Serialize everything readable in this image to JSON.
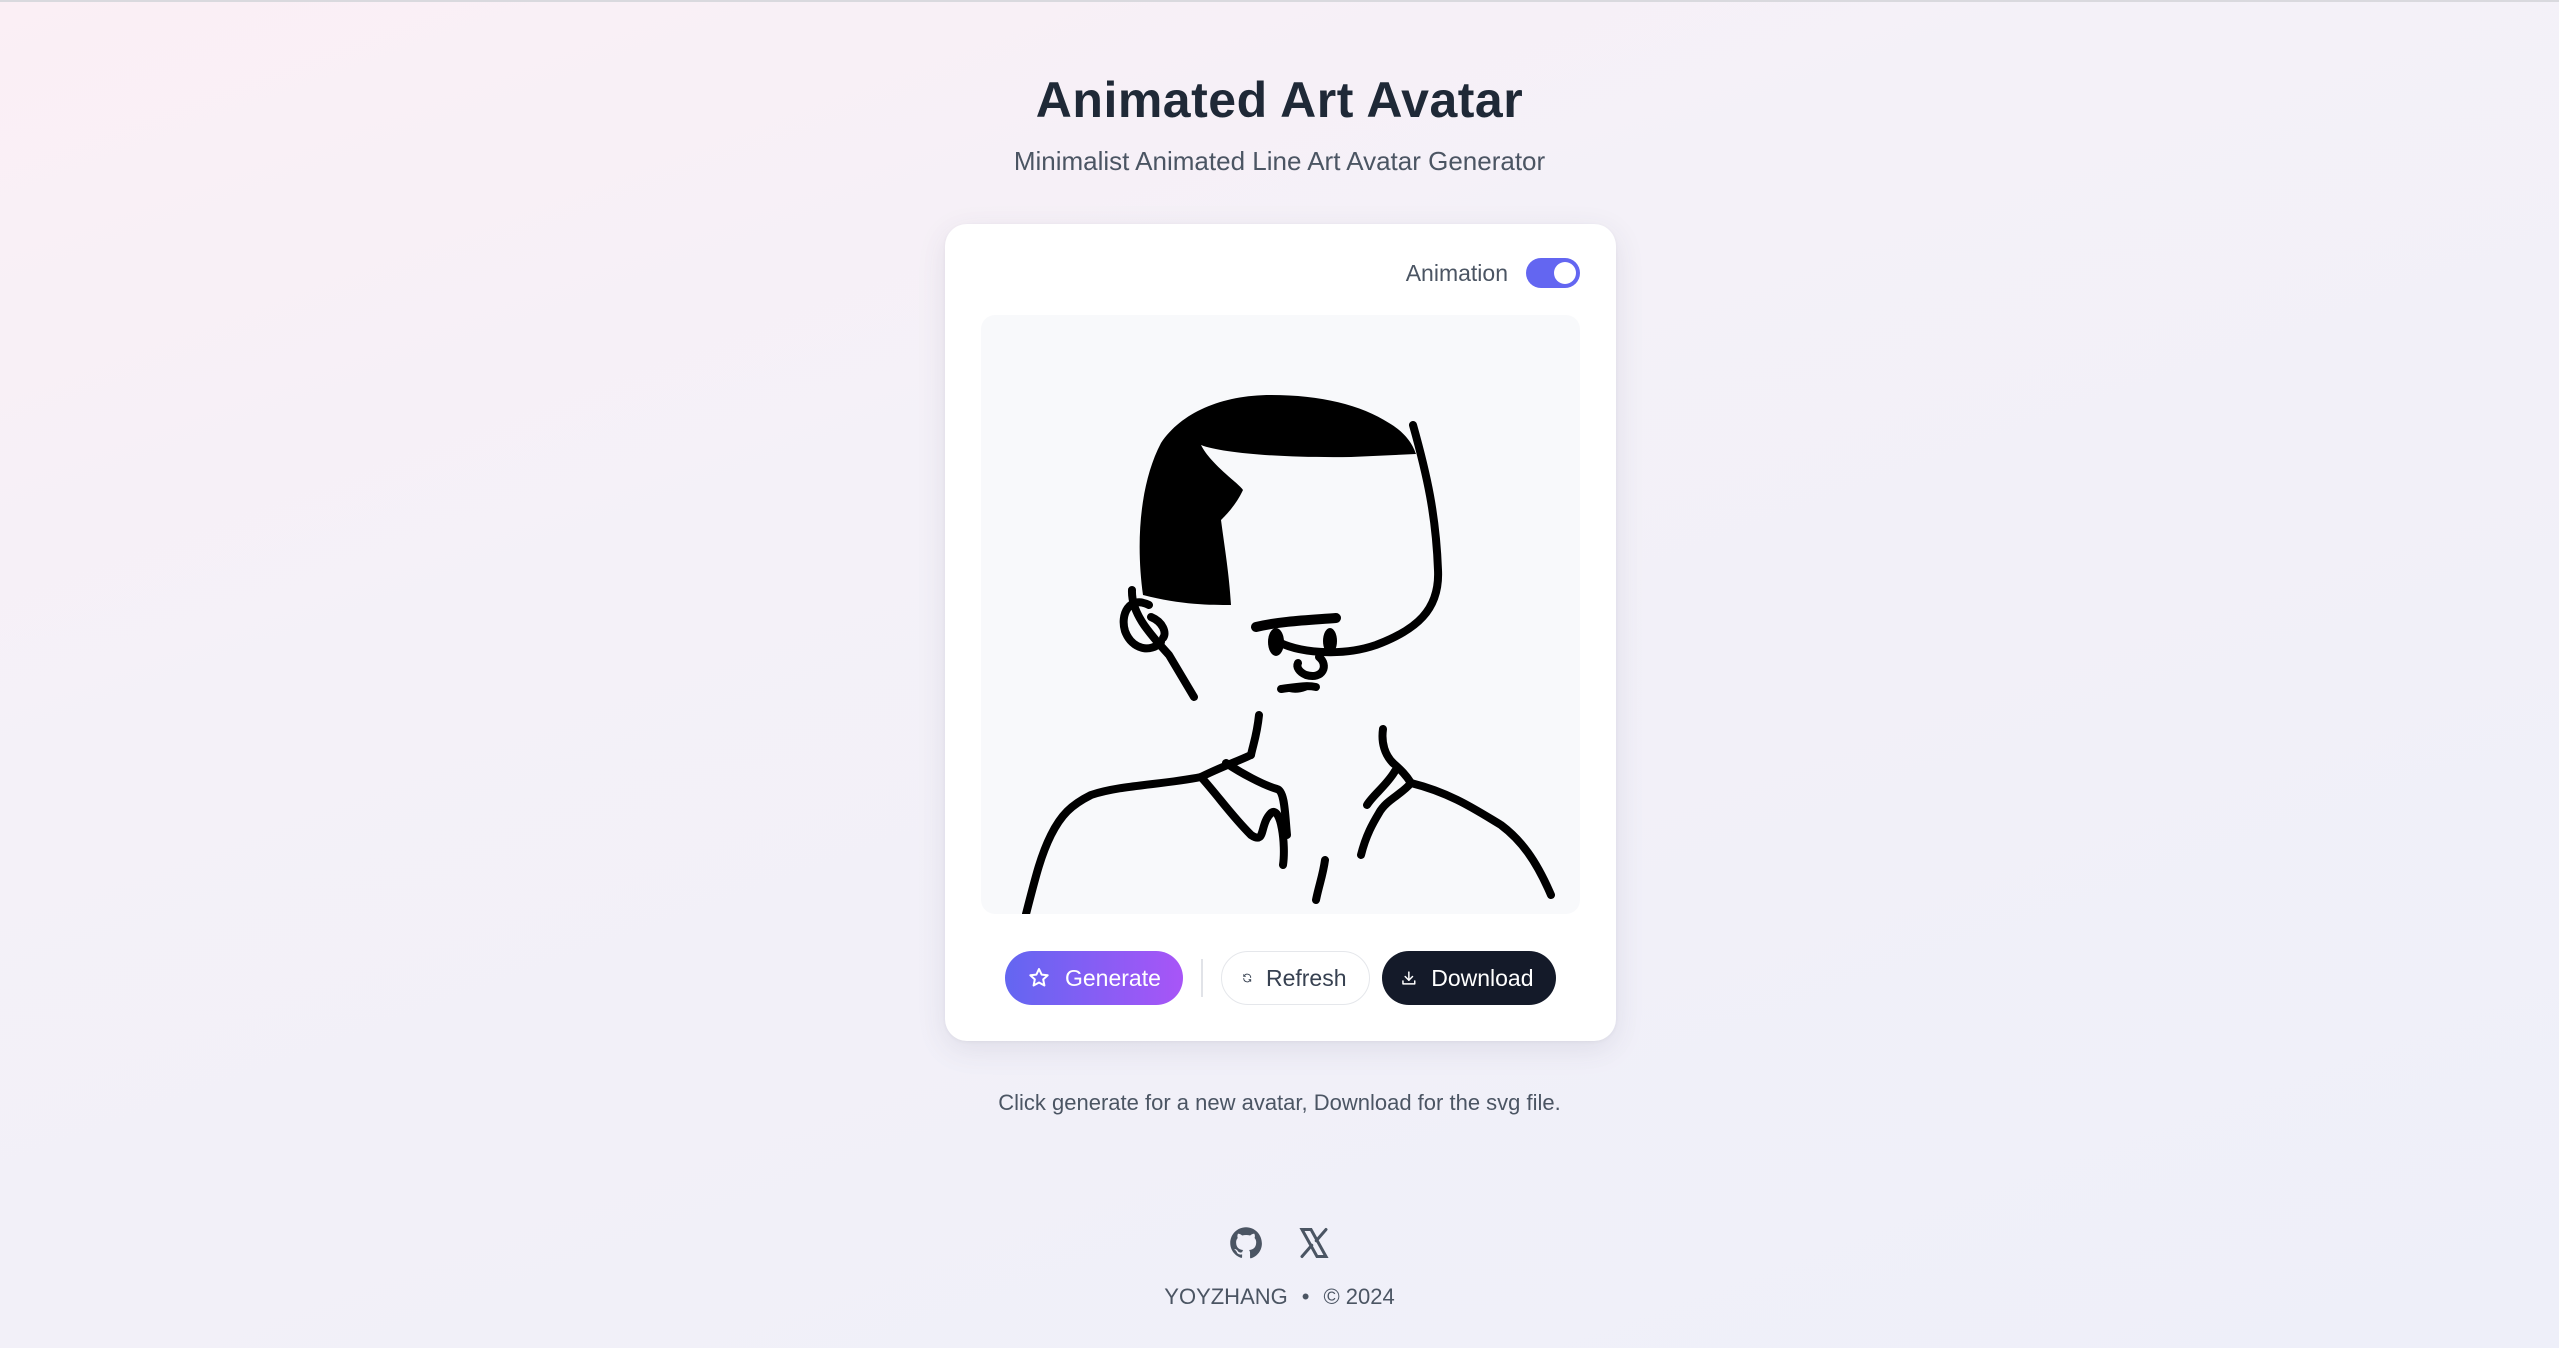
{
  "header": {
    "title": "Animated Art Avatar",
    "subtitle": "Minimalist Animated Line Art Avatar Generator"
  },
  "card": {
    "animation_label": "Animation",
    "animation_enabled": true,
    "avatar_alt": "line-art-avatar"
  },
  "actions": {
    "generate_label": "Generate",
    "refresh_label": "Refresh",
    "download_label": "Download"
  },
  "hint": "Click generate for a new avatar, Download for the svg file.",
  "social": {
    "icons": [
      "github-icon",
      "x-icon"
    ]
  },
  "footer": {
    "author": "YOYZHANG",
    "separator": "•",
    "copyright": "© 2024"
  },
  "colors": {
    "accent": "#6366f1",
    "accent_end": "#a855f7",
    "dark_button": "#141a29"
  }
}
